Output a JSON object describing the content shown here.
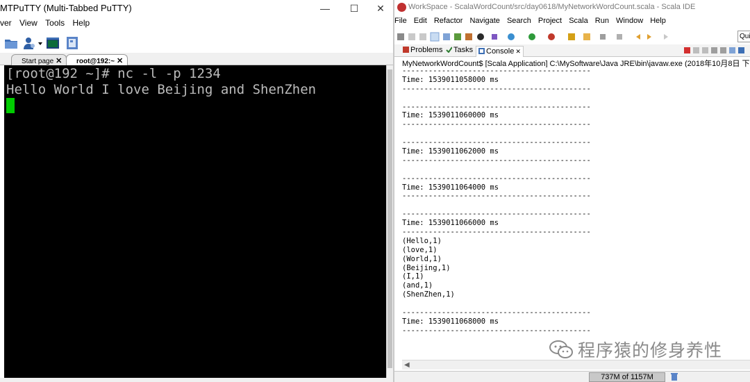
{
  "colors": {
    "terminal_bg": "#000000",
    "terminal_text": "#bbbbbb",
    "cursor": "#00cc00",
    "accent": "#3d6fb5"
  },
  "putty": {
    "title": "MTPuTTY (Multi-Tabbed PuTTY)",
    "window_controls": {
      "minimize": "—",
      "maximize": "☐",
      "close": "✕"
    },
    "menu": [
      "ver",
      "View",
      "Tools",
      "Help"
    ],
    "toolbar_icons": [
      "folder-icon",
      "connect-person-icon",
      "terminal-icon",
      "script-icon"
    ],
    "tabs": [
      {
        "label": "Start page",
        "close": "✕"
      },
      {
        "label": "root@192:~",
        "close": "✕"
      }
    ],
    "terminal": {
      "prompt_line": "[root@192 ~]# nc -l -p 1234",
      "output_line": "Hello World I love Beijing and ShenZhen"
    }
  },
  "ide": {
    "title": "WorkSpace - ScalaWordCount/src/day0618/MyNetworkWordCount.scala - Scala IDE",
    "menu": [
      "File",
      "Edit",
      "Refactor",
      "Navigate",
      "Search",
      "Project",
      "Scala",
      "Run",
      "Window",
      "Help"
    ],
    "quick_access": "Qui",
    "tabs": [
      {
        "label": "Problems"
      },
      {
        "label": "Tasks"
      },
      {
        "label": "Console"
      }
    ],
    "console_header": "MyNetworkWordCount$ [Scala Application] C:\\MySoftware\\Java JRE\\bin\\javaw.exe (2018年10月8日 下午",
    "console_lines": [
      "-------------------------------------------",
      "Time: 1539011058000 ms",
      "-------------------------------------------",
      "",
      "-------------------------------------------",
      "Time: 1539011060000 ms",
      "-------------------------------------------",
      "",
      "-------------------------------------------",
      "Time: 1539011062000 ms",
      "-------------------------------------------",
      "",
      "-------------------------------------------",
      "Time: 1539011064000 ms",
      "-------------------------------------------",
      "",
      "-------------------------------------------",
      "Time: 1539011066000 ms",
      "-------------------------------------------",
      "(Hello,1)",
      "(love,1)",
      "(World,1)",
      "(Beijing,1)",
      "(I,1)",
      "(and,1)",
      "(ShenZhen,1)",
      "",
      "-------------------------------------------",
      "Time: 1539011068000 ms",
      "-------------------------------------------"
    ],
    "heap_status": "737M of 1157M"
  },
  "watermark": {
    "text": "程序猿的修身养性"
  }
}
